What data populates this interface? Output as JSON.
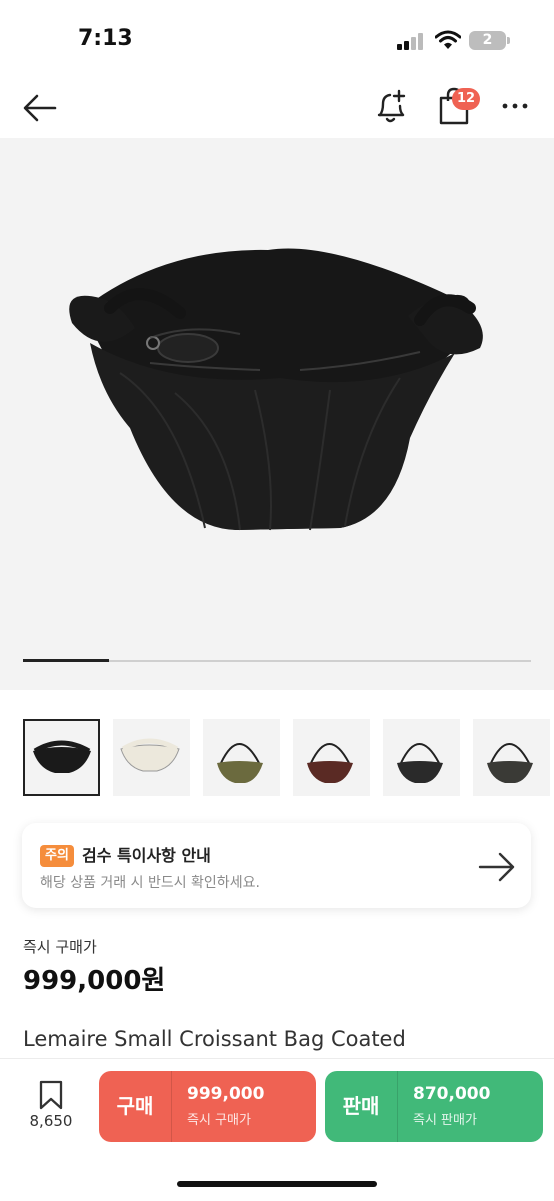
{
  "status_bar": {
    "time": "7:13",
    "battery": "2"
  },
  "nav": {
    "cart_badge": "12",
    "icons": [
      "back-arrow-icon",
      "bell-plus-icon",
      "shopping-bag-icon",
      "more-icon"
    ]
  },
  "hero": {
    "progress": 0.17
  },
  "thumbnails": [
    {
      "color": "#1a1a1a",
      "label": "black"
    },
    {
      "color": "#ece8dc",
      "label": "cream"
    },
    {
      "color": "#6b6a3e",
      "label": "olive"
    },
    {
      "color": "#5a2a24",
      "label": "burgundy"
    },
    {
      "color": "#2a2a2a",
      "label": "black"
    },
    {
      "color": "#3a3a36",
      "label": "dark"
    }
  ],
  "notice": {
    "tag": "주의",
    "title": "검수 특이사항 안내",
    "subtitle": "해당 상품 거래 시 반드시 확인하세요."
  },
  "price": {
    "label": "즉시 구매가",
    "value": "999,000원"
  },
  "product": {
    "name": "Lemaire Small Croissant Bag Coated"
  },
  "bottom": {
    "bookmark_count": "8,650",
    "buy": {
      "label": "구매",
      "price": "999,000",
      "sub": "즉시 구매가"
    },
    "sell": {
      "label": "판매",
      "price": "870,000",
      "sub": "즉시 판매가"
    }
  },
  "colors": {
    "buy": "#ef6253",
    "sell": "#41b979",
    "notice_tag": "#f58d3c",
    "badge": "#ef6253"
  }
}
